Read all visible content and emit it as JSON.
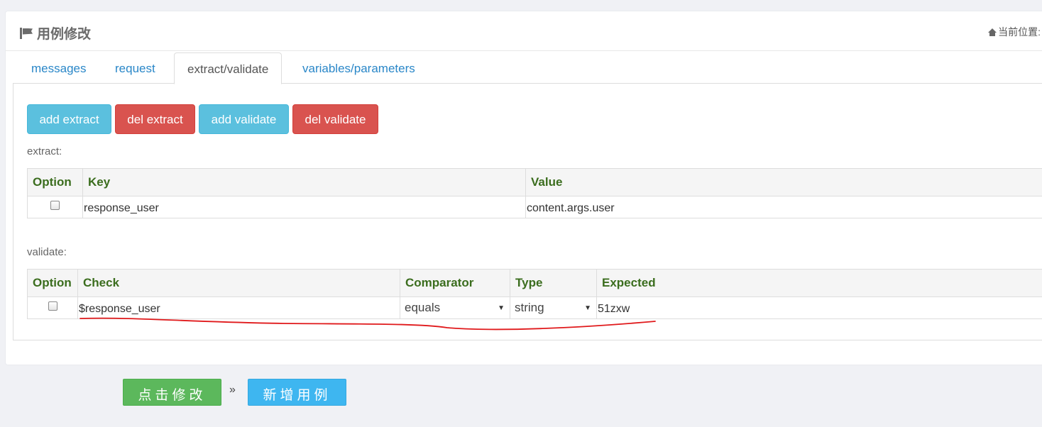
{
  "header": {
    "title": "用例修改",
    "breadcrumb": "当前位置:"
  },
  "tabs": [
    {
      "label": "messages"
    },
    {
      "label": "request"
    },
    {
      "label": "extract/validate",
      "active": true
    },
    {
      "label": "variables/parameters"
    }
  ],
  "toolbar": {
    "add_extract": "add extract",
    "del_extract": "del extract",
    "add_validate": "add validate",
    "del_validate": "del validate"
  },
  "extract": {
    "label": "extract:",
    "columns": [
      "Option",
      "Key",
      "Value"
    ],
    "rows": [
      {
        "key": "response_user",
        "value": "content.args.user"
      }
    ]
  },
  "validate": {
    "label": "validate:",
    "columns": [
      "Option",
      "Check",
      "Comparator",
      "Type",
      "Expected"
    ],
    "rows": [
      {
        "check": "$response_user",
        "comparator": "equals",
        "type": "string",
        "expected": "51zxw"
      }
    ]
  },
  "actions": {
    "submit": "点击修改",
    "separator": "»",
    "new_case": "新增用例"
  },
  "colors": {
    "annotation": "#e0191b",
    "header_text": "#3b6d1e",
    "tab_link": "#2a87c8"
  }
}
